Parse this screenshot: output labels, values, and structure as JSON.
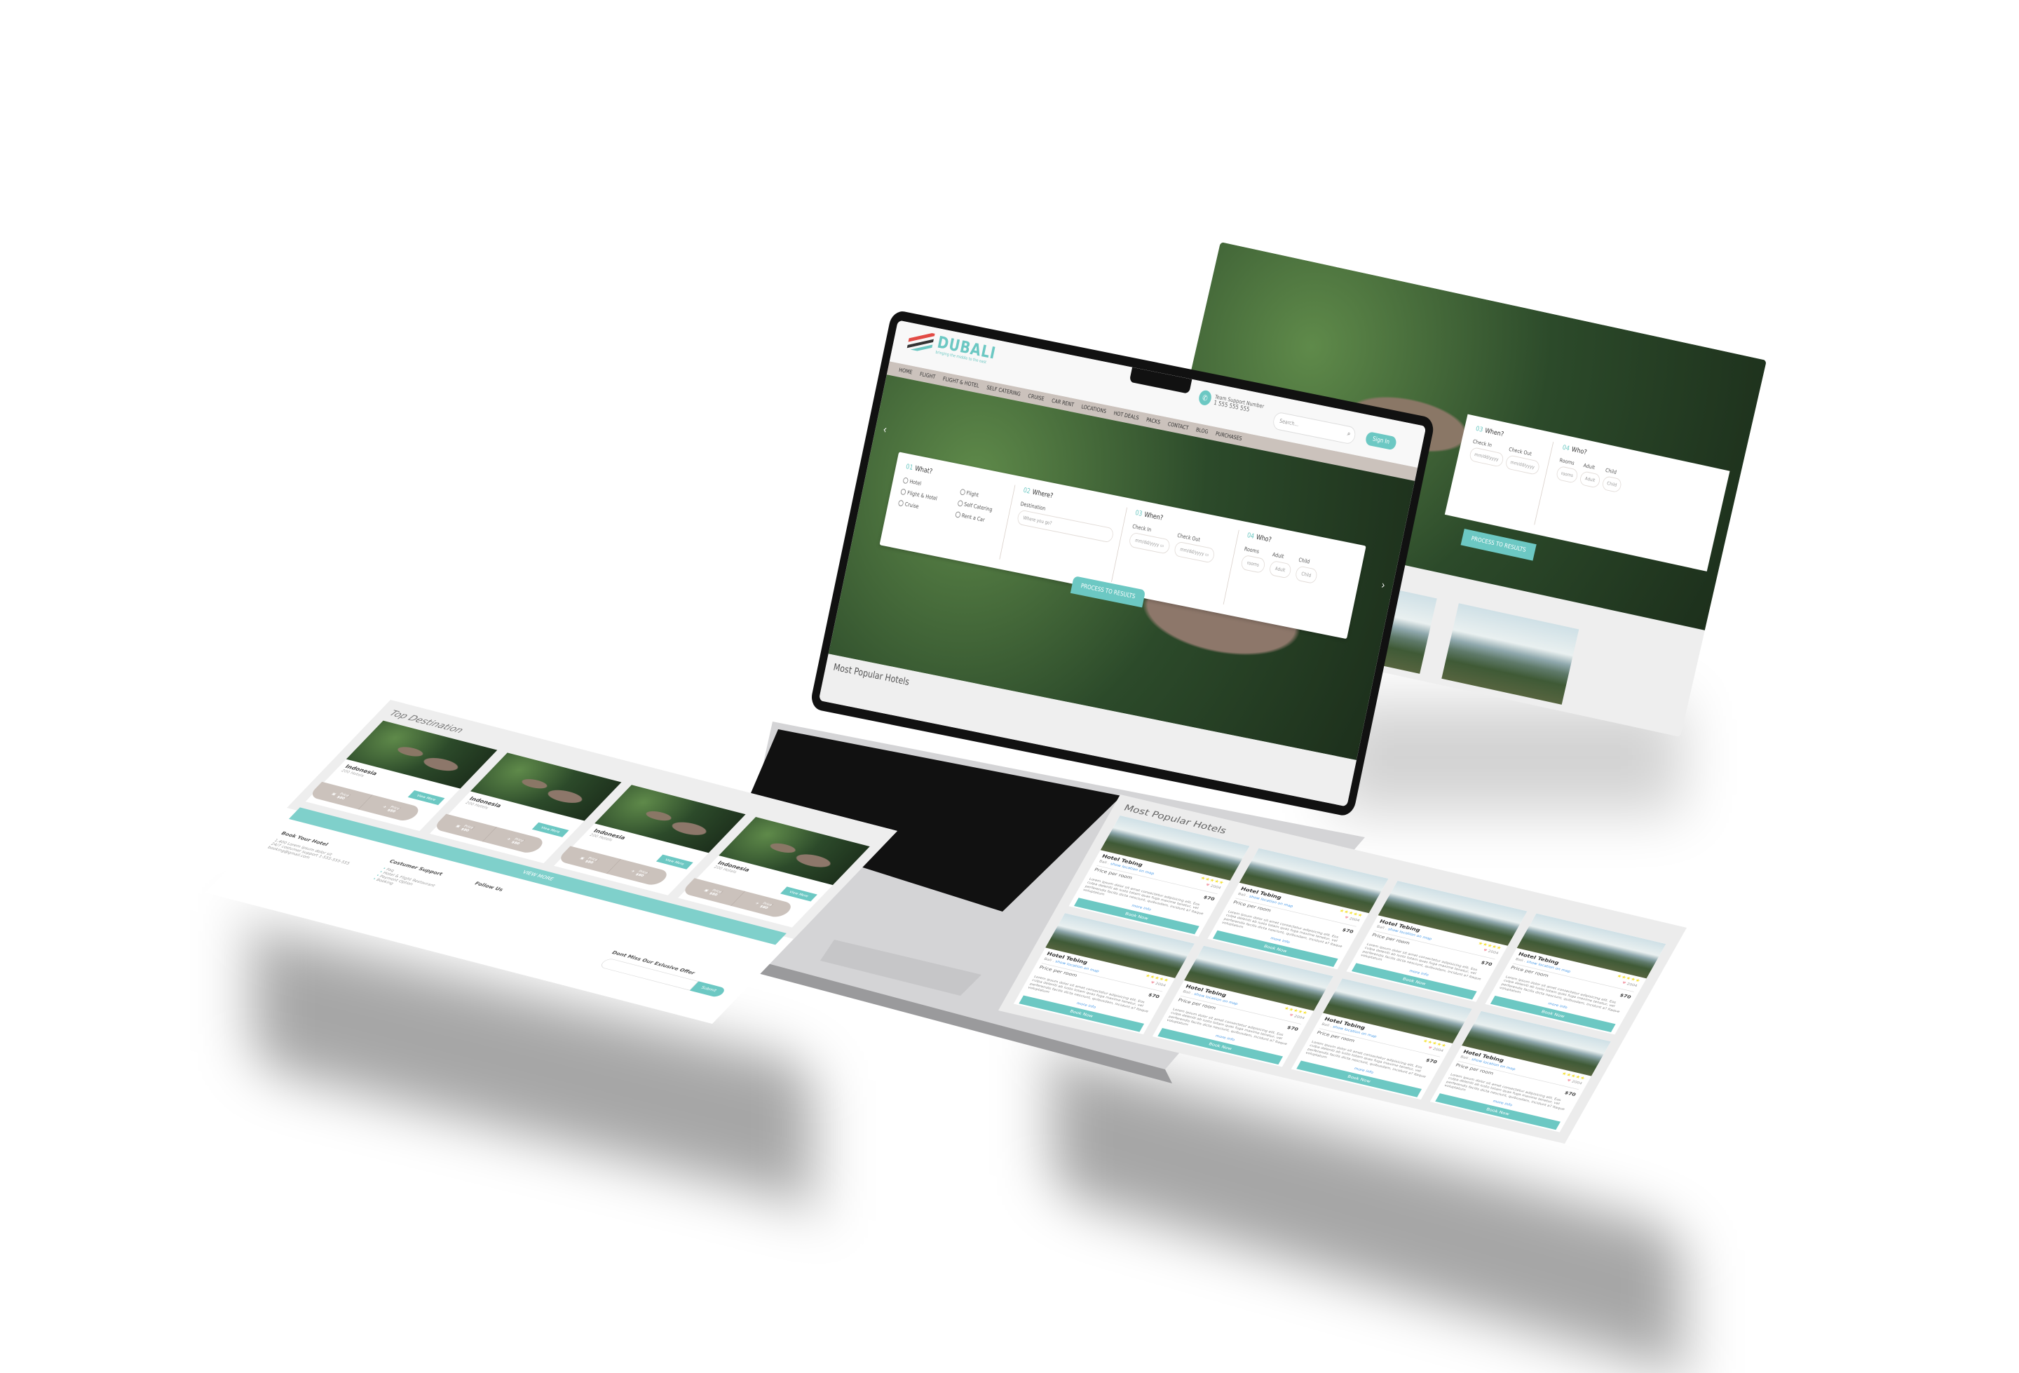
{
  "colors": {
    "accent": "#6cc8c3",
    "nav_bg": "#cbc2bc",
    "logo_red": "#e24b45"
  },
  "site": {
    "logo_text": "DUBALI",
    "tagline": "bringing the middle to the east",
    "phone_label": "Team Support Number",
    "phone_number": "1 555 555 555",
    "phone_icon": "phone-icon",
    "search_placeholder": "Search...",
    "sign_in": "Sign In",
    "nav": [
      "HOME",
      "FLIGHT",
      "FLIGHT & HOTEL",
      "SELF CATERING",
      "CRUISE",
      "CAR RENT",
      "LOCATIONS",
      "HOT DEALS",
      "PACKS",
      "CONTACT",
      "BLOG",
      "PURCHASES"
    ]
  },
  "booking": {
    "what": {
      "num": "01",
      "title": "What?",
      "options": [
        "Hotel",
        "Flight",
        "Flight & Hotel",
        "Self Catering",
        "Cruise",
        "Rent a Car"
      ]
    },
    "where": {
      "num": "02",
      "title": "Where?",
      "label": "Destination",
      "placeholder": "Where you go?"
    },
    "when": {
      "num": "03",
      "title": "When?",
      "check_in": "Check In",
      "check_out": "Check Out",
      "date_placeholder": "mm/dd/yyyy"
    },
    "who": {
      "num": "04",
      "title": "Who?",
      "rooms": "Rooms",
      "rooms_ph": "rooms",
      "adult": "Adult",
      "adult_ph": "Adult",
      "child": "Child",
      "child_ph": "Child"
    },
    "submit": "PROCESS TO RESULTS"
  },
  "popular_title": "Most Popular Hotels",
  "top_destination": {
    "title": "Top Destination",
    "cards": [
      {
        "name": "Indonesia",
        "hotels": "200 Hotels",
        "view": "View More",
        "hotel_price_label": "Price",
        "hotel_price": "$80",
        "flight_price_label": "Price",
        "flight_price": "$80"
      },
      {
        "name": "Indonesia",
        "hotels": "200 Hotels",
        "view": "View More",
        "hotel_price_label": "Price",
        "hotel_price": "$80",
        "flight_price_label": "Price",
        "flight_price": "$80"
      },
      {
        "name": "Indonesia",
        "hotels": "200 Hotels",
        "view": "View More",
        "hotel_price_label": "Price",
        "hotel_price": "$80",
        "flight_price_label": "Price",
        "flight_price": "$80"
      },
      {
        "name": "Indonesia",
        "hotels": "200 Hotels",
        "view": "View More",
        "hotel_price_label": "Price",
        "hotel_price": "$80",
        "flight_price_label": "Price",
        "flight_price": "$80"
      }
    ],
    "view_all": "VIEW MORE"
  },
  "footer": {
    "book_title": "Book Your Hotel",
    "book_lines": [
      "1.400 Lorem ipsum dolor sit",
      "24/7 costumer support 1-555-555-555",
      "booking@gmail.com"
    ],
    "support_title": "Costumer Support",
    "support_links": [
      "Faq",
      "Hotel & Flight Restaurant",
      "Payment Option",
      "Booking"
    ],
    "follow_title": "Follow Us",
    "newsletter_title": "Dont Miss Our Exlusive Offer",
    "submit": "Submit"
  },
  "hotels": {
    "title": "Most Popular Hotels",
    "card": {
      "name": "Hotel Tebing",
      "location": "Bali .",
      "map_link": "show location on map",
      "rating": 5,
      "likes": "2004",
      "price_label": "Price per room",
      "price": "$70",
      "description": "Lorem ipsum dolor sit amet consectetur adipisicing elit. Eos culpa deleniti ab iusto totam quas fuga maxime tenetur, vel perferendis facilis dicta nesciunt, quibusdam, incidunt a? Itaque voluptatum",
      "more": "more info",
      "book": "Book Now"
    },
    "count": 8
  },
  "back_screen": {
    "when_num": "03",
    "when": "When?",
    "who_num": "04",
    "who": "Who?",
    "check_in": "Check In",
    "check_out": "Check Out",
    "date_placeholder": "mm/dd/yyyy",
    "rooms": "Rooms",
    "rooms_ph": "rooms",
    "adult": "Adult",
    "adult_ph": "Adult",
    "child": "Child",
    "child_ph": "Child",
    "submit": "PROCESS TO RESULTS"
  }
}
